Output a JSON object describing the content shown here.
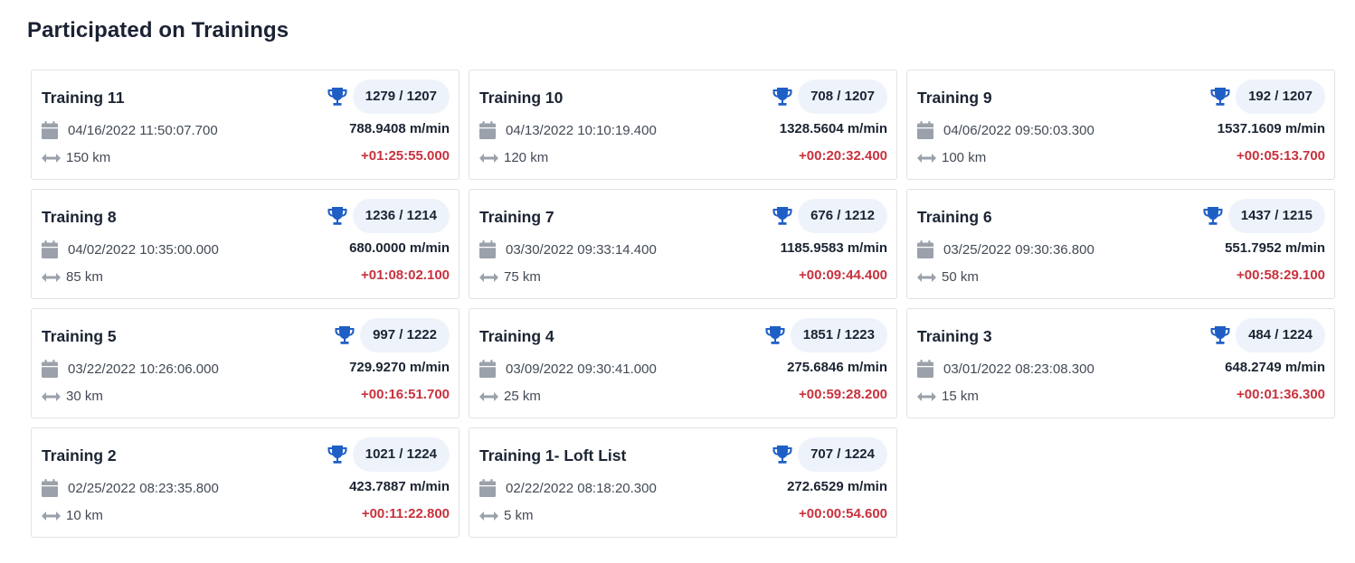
{
  "page": {
    "title": "Participated on Trainings"
  },
  "colors": {
    "accent": "#1f5fc5",
    "delta": "#c8323d",
    "muted_icon": "#9aa1aa",
    "pill_bg": "#eef3fb"
  },
  "icons": {
    "rank": "trophy-icon",
    "date": "calendar-icon",
    "distance": "double-arrow-icon"
  },
  "trainings": [
    {
      "name": "Training 11",
      "rank": "1279 / 1207",
      "date": "04/16/2022 11:50:07.700",
      "distance": "150 km",
      "speed": "788.9408 m/min",
      "delta": "+01:25:55.000"
    },
    {
      "name": "Training 10",
      "rank": "708 / 1207",
      "date": "04/13/2022 10:10:19.400",
      "distance": "120 km",
      "speed": "1328.5604 m/min",
      "delta": "+00:20:32.400"
    },
    {
      "name": "Training 9",
      "rank": "192 / 1207",
      "date": "04/06/2022 09:50:03.300",
      "distance": "100 km",
      "speed": "1537.1609 m/min",
      "delta": "+00:05:13.700"
    },
    {
      "name": "Training 8",
      "rank": "1236 / 1214",
      "date": "04/02/2022 10:35:00.000",
      "distance": "85 km",
      "speed": "680.0000 m/min",
      "delta": "+01:08:02.100"
    },
    {
      "name": "Training 7",
      "rank": "676 / 1212",
      "date": "03/30/2022 09:33:14.400",
      "distance": "75 km",
      "speed": "1185.9583 m/min",
      "delta": "+00:09:44.400"
    },
    {
      "name": "Training 6",
      "rank": "1437 / 1215",
      "date": "03/25/2022 09:30:36.800",
      "distance": "50 km",
      "speed": "551.7952 m/min",
      "delta": "+00:58:29.100"
    },
    {
      "name": "Training 5",
      "rank": "997 / 1222",
      "date": "03/22/2022 10:26:06.000",
      "distance": "30 km",
      "speed": "729.9270 m/min",
      "delta": "+00:16:51.700"
    },
    {
      "name": "Training 4",
      "rank": "1851 / 1223",
      "date": "03/09/2022 09:30:41.000",
      "distance": "25 km",
      "speed": "275.6846 m/min",
      "delta": "+00:59:28.200"
    },
    {
      "name": "Training 3",
      "rank": "484 / 1224",
      "date": "03/01/2022 08:23:08.300",
      "distance": "15 km",
      "speed": "648.2749 m/min",
      "delta": "+00:01:36.300"
    },
    {
      "name": "Training 2",
      "rank": "1021 / 1224",
      "date": "02/25/2022 08:23:35.800",
      "distance": "10 km",
      "speed": "423.7887 m/min",
      "delta": "+00:11:22.800"
    },
    {
      "name": "Training 1- Loft List",
      "rank": "707 / 1224",
      "date": "02/22/2022 08:18:20.300",
      "distance": "5 km",
      "speed": "272.6529 m/min",
      "delta": "+00:00:54.600"
    }
  ]
}
